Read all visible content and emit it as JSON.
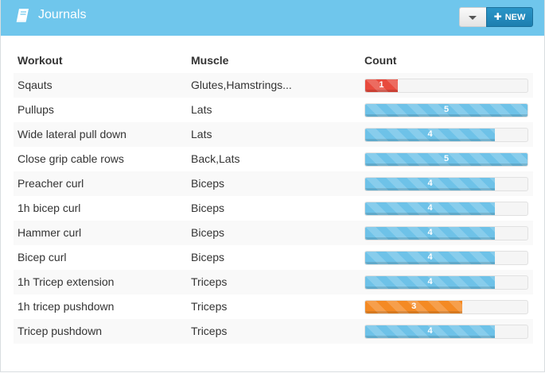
{
  "header": {
    "title": "Journals",
    "new_label": "NEW",
    "color": "#6fc6ec"
  },
  "table": {
    "columns": [
      "Workout",
      "Muscle",
      "Count"
    ],
    "max_count": 5,
    "rows": [
      {
        "workout": "Sqauts",
        "muscle": "Glutes,Hamstrings...",
        "count": "1",
        "level": 0.2,
        "color": "#e84a3d"
      },
      {
        "workout": "Pullups",
        "muscle": "Lats",
        "count": "5",
        "level": 1.0,
        "color": "#6ec2e8"
      },
      {
        "workout": "Wide lateral pull down",
        "muscle": "Lats",
        "count": "4",
        "level": 0.8,
        "color": "#6ec2e8"
      },
      {
        "workout": "Close grip cable rows",
        "muscle": "Back,Lats",
        "count": "5",
        "level": 1.0,
        "color": "#6ec2e8"
      },
      {
        "workout": "Preacher curl",
        "muscle": "Biceps",
        "count": "4",
        "level": 0.8,
        "color": "#6ec2e8"
      },
      {
        "workout": "1h bicep curl",
        "muscle": "Biceps",
        "count": "4",
        "level": 0.8,
        "color": "#6ec2e8"
      },
      {
        "workout": "Hammer curl",
        "muscle": "Biceps",
        "count": "4",
        "level": 0.8,
        "color": "#6ec2e8"
      },
      {
        "workout": "Bicep curl",
        "muscle": "Biceps",
        "count": "4",
        "level": 0.8,
        "color": "#6ec2e8"
      },
      {
        "workout": "1h Tricep extension",
        "muscle": "Triceps",
        "count": "4",
        "level": 0.8,
        "color": "#6ec2e8"
      },
      {
        "workout": "1h tricep pushdown",
        "muscle": "Triceps",
        "count": "3",
        "level": 0.6,
        "color": "#f48a24"
      },
      {
        "workout": "Tricep pushdown",
        "muscle": "Triceps",
        "count": "4",
        "level": 0.8,
        "color": "#6ec2e8"
      }
    ]
  },
  "icons": {
    "header": "book-icon",
    "dropdown": "caret-down-icon",
    "new": "plus-icon"
  }
}
